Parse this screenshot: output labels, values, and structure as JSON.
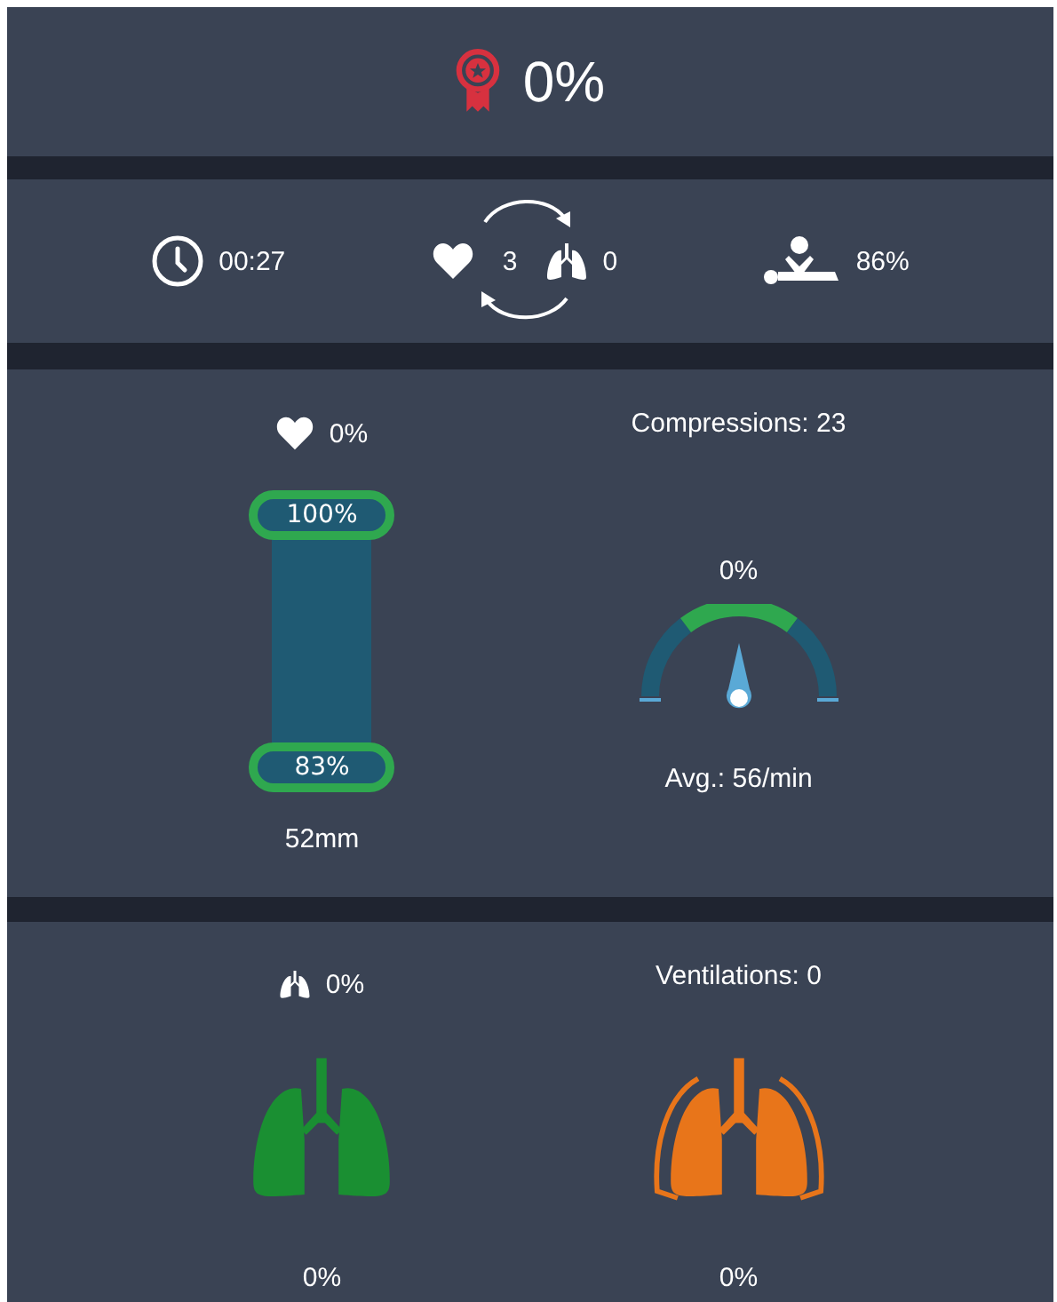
{
  "score": {
    "value": "0%"
  },
  "summary": {
    "time": "00:27",
    "cycles": "3",
    "ventilation_count": "0",
    "cpr_quality": "86%"
  },
  "compressions": {
    "quality": "0%",
    "depth_upper": "100%",
    "depth_lower": "83%",
    "depth": "52mm",
    "count_label": "Compressions: 23",
    "rate_quality": "0%",
    "average_rate": "Avg.: 56/min"
  },
  "ventilations": {
    "quality": "0%",
    "count_label": "Ventilations: 0",
    "lungs": [
      {
        "color": "#1a8f32",
        "reading": "0%",
        "outlined": false
      },
      {
        "color": "#e8751a",
        "reading": "0%",
        "outlined": true
      }
    ]
  }
}
